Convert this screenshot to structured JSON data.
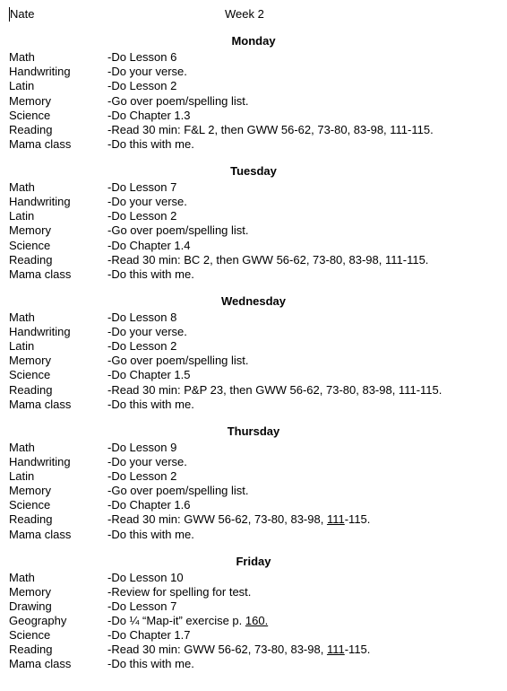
{
  "header": {
    "name": "Nate",
    "week": "Week 2"
  },
  "days": [
    {
      "title": "Monday",
      "items": [
        {
          "subject": "Math",
          "task": "-Do Lesson 6"
        },
        {
          "subject": "Handwriting",
          "task": "-Do your verse."
        },
        {
          "subject": "Latin",
          "task": "-Do Lesson 2"
        },
        {
          "subject": "Memory",
          "task": "-Go over poem/spelling list."
        },
        {
          "subject": "Science",
          "task": "-Do Chapter 1.3"
        },
        {
          "subject": "Reading",
          "task": "-Read 30 min:  F&L 2, then GWW 56-62,  73-80, 83-98,  111-115."
        },
        {
          "subject": "Mama class",
          "task": "-Do this with me."
        }
      ]
    },
    {
      "title": "Tuesday",
      "items": [
        {
          "subject": "Math",
          "task": "-Do Lesson 7"
        },
        {
          "subject": "Handwriting",
          "task": "-Do your verse."
        },
        {
          "subject": "Latin",
          "task": "-Do Lesson 2"
        },
        {
          "subject": "Memory",
          "task": "-Go over poem/spelling list."
        },
        {
          "subject": "Science",
          "task": "-Do Chapter 1.4"
        },
        {
          "subject": "Reading",
          "task": "-Read 30 min:  BC 2, then GWW 56-62,  73-80, 83-98,  111-115."
        },
        {
          "subject": "Mama class",
          "task": "-Do this with me."
        }
      ]
    },
    {
      "title": "Wednesday",
      "items": [
        {
          "subject": "Math",
          "task": "-Do Lesson 8"
        },
        {
          "subject": "Handwriting",
          "task": "-Do your verse."
        },
        {
          "subject": "Latin",
          "task": "-Do Lesson 2"
        },
        {
          "subject": "Memory",
          "task": "-Go over poem/spelling list."
        },
        {
          "subject": "Science",
          "task": "-Do Chapter 1.5"
        },
        {
          "subject": "Reading",
          "task": "-Read 30 min: P&P 23, then GWW 56-62,  73-80, 83-98,  111-115."
        },
        {
          "subject": "Mama class",
          "task": "-Do this with me."
        }
      ]
    },
    {
      "title": "Thursday",
      "items": [
        {
          "subject": "Math",
          "task": "-Do Lesson 9"
        },
        {
          "subject": "Handwriting",
          "task": "-Do your verse."
        },
        {
          "subject": "Latin",
          "task": "-Do Lesson 2"
        },
        {
          "subject": "Memory",
          "task": "-Go over poem/spelling list."
        },
        {
          "subject": "Science",
          "task": "-Do Chapter 1.6"
        },
        {
          "subject": "Reading",
          "task_html": "-Read 30 min: GWW 56-62,  73-80, 83-98,  <u>111</u>-115."
        },
        {
          "subject": "Mama class",
          "task": "-Do this with me."
        }
      ]
    },
    {
      "title": "Friday",
      "items": [
        {
          "subject": "Math",
          "task": "-Do Lesson 10"
        },
        {
          "subject": "Memory",
          "task": "-Review  for spelling for test."
        },
        {
          "subject": "Drawing",
          "task": "-Do Lesson 7"
        },
        {
          "subject": "Geography",
          "task_html": "-Do ¼ “Map-it” exercise p. <u>160.</u>"
        },
        {
          "subject": "Science",
          "task": "-Do Chapter 1.7"
        },
        {
          "subject": "Reading",
          "task_html": "-Read 30 min: GWW 56-62,  73-80, 83-98,  <u>111</u>-115."
        },
        {
          "subject": "Mama class",
          "task": "-Do this with me."
        }
      ]
    }
  ]
}
